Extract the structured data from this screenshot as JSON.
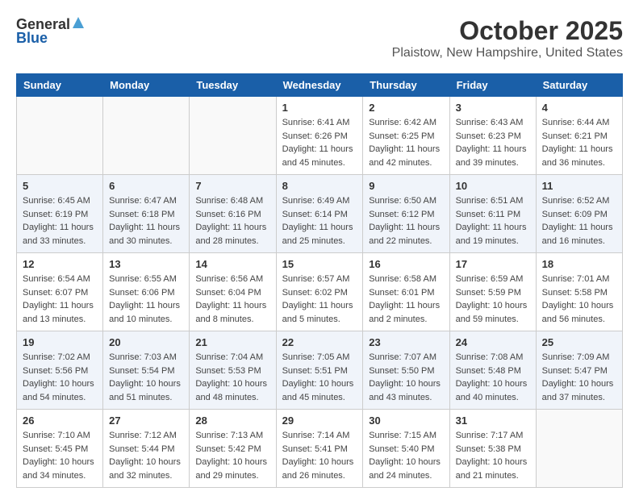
{
  "header": {
    "logo_general": "General",
    "logo_blue": "Blue",
    "month": "October 2025",
    "location": "Plaistow, New Hampshire, United States"
  },
  "weekdays": [
    "Sunday",
    "Monday",
    "Tuesday",
    "Wednesday",
    "Thursday",
    "Friday",
    "Saturday"
  ],
  "weeks": [
    [
      {
        "day": "",
        "sunrise": "",
        "sunset": "",
        "daylight": ""
      },
      {
        "day": "",
        "sunrise": "",
        "sunset": "",
        "daylight": ""
      },
      {
        "day": "",
        "sunrise": "",
        "sunset": "",
        "daylight": ""
      },
      {
        "day": "1",
        "sunrise": "Sunrise: 6:41 AM",
        "sunset": "Sunset: 6:26 PM",
        "daylight": "Daylight: 11 hours and 45 minutes."
      },
      {
        "day": "2",
        "sunrise": "Sunrise: 6:42 AM",
        "sunset": "Sunset: 6:25 PM",
        "daylight": "Daylight: 11 hours and 42 minutes."
      },
      {
        "day": "3",
        "sunrise": "Sunrise: 6:43 AM",
        "sunset": "Sunset: 6:23 PM",
        "daylight": "Daylight: 11 hours and 39 minutes."
      },
      {
        "day": "4",
        "sunrise": "Sunrise: 6:44 AM",
        "sunset": "Sunset: 6:21 PM",
        "daylight": "Daylight: 11 hours and 36 minutes."
      }
    ],
    [
      {
        "day": "5",
        "sunrise": "Sunrise: 6:45 AM",
        "sunset": "Sunset: 6:19 PM",
        "daylight": "Daylight: 11 hours and 33 minutes."
      },
      {
        "day": "6",
        "sunrise": "Sunrise: 6:47 AM",
        "sunset": "Sunset: 6:18 PM",
        "daylight": "Daylight: 11 hours and 30 minutes."
      },
      {
        "day": "7",
        "sunrise": "Sunrise: 6:48 AM",
        "sunset": "Sunset: 6:16 PM",
        "daylight": "Daylight: 11 hours and 28 minutes."
      },
      {
        "day": "8",
        "sunrise": "Sunrise: 6:49 AM",
        "sunset": "Sunset: 6:14 PM",
        "daylight": "Daylight: 11 hours and 25 minutes."
      },
      {
        "day": "9",
        "sunrise": "Sunrise: 6:50 AM",
        "sunset": "Sunset: 6:12 PM",
        "daylight": "Daylight: 11 hours and 22 minutes."
      },
      {
        "day": "10",
        "sunrise": "Sunrise: 6:51 AM",
        "sunset": "Sunset: 6:11 PM",
        "daylight": "Daylight: 11 hours and 19 minutes."
      },
      {
        "day": "11",
        "sunrise": "Sunrise: 6:52 AM",
        "sunset": "Sunset: 6:09 PM",
        "daylight": "Daylight: 11 hours and 16 minutes."
      }
    ],
    [
      {
        "day": "12",
        "sunrise": "Sunrise: 6:54 AM",
        "sunset": "Sunset: 6:07 PM",
        "daylight": "Daylight: 11 hours and 13 minutes."
      },
      {
        "day": "13",
        "sunrise": "Sunrise: 6:55 AM",
        "sunset": "Sunset: 6:06 PM",
        "daylight": "Daylight: 11 hours and 10 minutes."
      },
      {
        "day": "14",
        "sunrise": "Sunrise: 6:56 AM",
        "sunset": "Sunset: 6:04 PM",
        "daylight": "Daylight: 11 hours and 8 minutes."
      },
      {
        "day": "15",
        "sunrise": "Sunrise: 6:57 AM",
        "sunset": "Sunset: 6:02 PM",
        "daylight": "Daylight: 11 hours and 5 minutes."
      },
      {
        "day": "16",
        "sunrise": "Sunrise: 6:58 AM",
        "sunset": "Sunset: 6:01 PM",
        "daylight": "Daylight: 11 hours and 2 minutes."
      },
      {
        "day": "17",
        "sunrise": "Sunrise: 6:59 AM",
        "sunset": "Sunset: 5:59 PM",
        "daylight": "Daylight: 10 hours and 59 minutes."
      },
      {
        "day": "18",
        "sunrise": "Sunrise: 7:01 AM",
        "sunset": "Sunset: 5:58 PM",
        "daylight": "Daylight: 10 hours and 56 minutes."
      }
    ],
    [
      {
        "day": "19",
        "sunrise": "Sunrise: 7:02 AM",
        "sunset": "Sunset: 5:56 PM",
        "daylight": "Daylight: 10 hours and 54 minutes."
      },
      {
        "day": "20",
        "sunrise": "Sunrise: 7:03 AM",
        "sunset": "Sunset: 5:54 PM",
        "daylight": "Daylight: 10 hours and 51 minutes."
      },
      {
        "day": "21",
        "sunrise": "Sunrise: 7:04 AM",
        "sunset": "Sunset: 5:53 PM",
        "daylight": "Daylight: 10 hours and 48 minutes."
      },
      {
        "day": "22",
        "sunrise": "Sunrise: 7:05 AM",
        "sunset": "Sunset: 5:51 PM",
        "daylight": "Daylight: 10 hours and 45 minutes."
      },
      {
        "day": "23",
        "sunrise": "Sunrise: 7:07 AM",
        "sunset": "Sunset: 5:50 PM",
        "daylight": "Daylight: 10 hours and 43 minutes."
      },
      {
        "day": "24",
        "sunrise": "Sunrise: 7:08 AM",
        "sunset": "Sunset: 5:48 PM",
        "daylight": "Daylight: 10 hours and 40 minutes."
      },
      {
        "day": "25",
        "sunrise": "Sunrise: 7:09 AM",
        "sunset": "Sunset: 5:47 PM",
        "daylight": "Daylight: 10 hours and 37 minutes."
      }
    ],
    [
      {
        "day": "26",
        "sunrise": "Sunrise: 7:10 AM",
        "sunset": "Sunset: 5:45 PM",
        "daylight": "Daylight: 10 hours and 34 minutes."
      },
      {
        "day": "27",
        "sunrise": "Sunrise: 7:12 AM",
        "sunset": "Sunset: 5:44 PM",
        "daylight": "Daylight: 10 hours and 32 minutes."
      },
      {
        "day": "28",
        "sunrise": "Sunrise: 7:13 AM",
        "sunset": "Sunset: 5:42 PM",
        "daylight": "Daylight: 10 hours and 29 minutes."
      },
      {
        "day": "29",
        "sunrise": "Sunrise: 7:14 AM",
        "sunset": "Sunset: 5:41 PM",
        "daylight": "Daylight: 10 hours and 26 minutes."
      },
      {
        "day": "30",
        "sunrise": "Sunrise: 7:15 AM",
        "sunset": "Sunset: 5:40 PM",
        "daylight": "Daylight: 10 hours and 24 minutes."
      },
      {
        "day": "31",
        "sunrise": "Sunrise: 7:17 AM",
        "sunset": "Sunset: 5:38 PM",
        "daylight": "Daylight: 10 hours and 21 minutes."
      },
      {
        "day": "",
        "sunrise": "",
        "sunset": "",
        "daylight": ""
      }
    ]
  ]
}
